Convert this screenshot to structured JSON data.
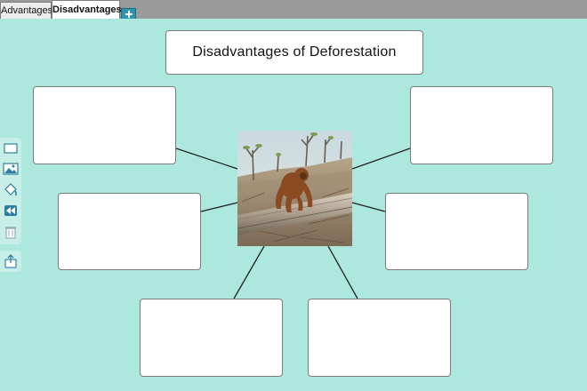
{
  "tabs": [
    {
      "label": "Advantages",
      "active": false
    },
    {
      "label": "Disadvantages",
      "active": true
    }
  ],
  "diagram": {
    "title": "Disadvantages of Deforestation",
    "cards": [
      "",
      "",
      "",
      "",
      "",
      ""
    ]
  },
  "toolbar": {
    "tools": [
      "rectangle-icon",
      "image-icon",
      "fill-bucket-icon",
      "rewind-icon",
      "trash-icon",
      "share-icon"
    ]
  },
  "colors": {
    "background": "#ade8df",
    "tabbar": "#9a9a9a",
    "accent": "#2f93ad"
  }
}
